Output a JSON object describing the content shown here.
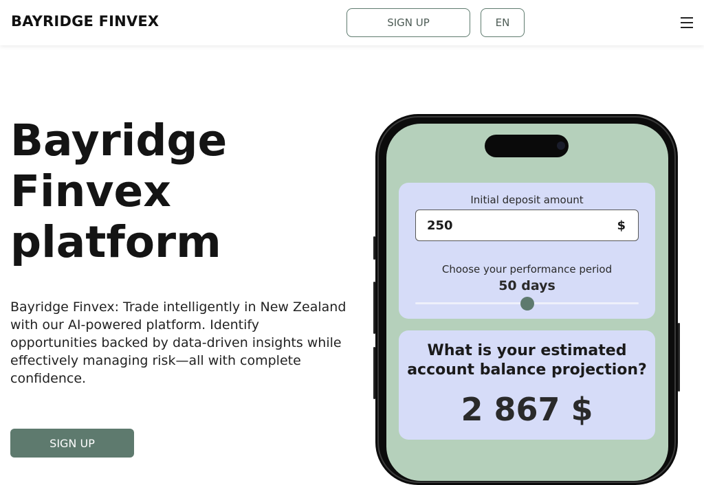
{
  "header": {
    "brand": "BAYRIDGE FINVEX",
    "signup_label": "SIGN UP",
    "language_label": "EN",
    "menu_icon": "hamburger-menu-icon"
  },
  "hero": {
    "title_lines": [
      "Bayridge",
      "Finvex",
      "platform"
    ],
    "description": "Bayridge Finvex: Trade intelligently in New Zealand with our AI-powered platform. Identify opportunities backed by data-driven insights while effectively managing risk—all with complete confidence.",
    "cta_label": "SIGN UP"
  },
  "calculator": {
    "deposit_label": "Initial deposit amount",
    "deposit_value": "250",
    "deposit_currency": "$",
    "period_label": "Choose your performance period",
    "period_value": "50 days",
    "slider_fraction": 0.5,
    "question": "What is your estimated account balance projection?",
    "result": "2 867 $"
  },
  "colors": {
    "accent": "#5e7a6e",
    "phone_screen": "#b5d0bb",
    "card_bg": "#d6dcf8"
  }
}
